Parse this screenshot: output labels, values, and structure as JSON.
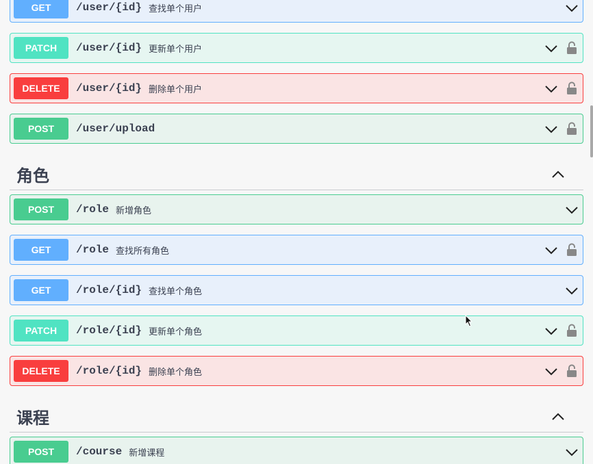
{
  "sections": {
    "role": {
      "title": "角色"
    },
    "course": {
      "title": "课程"
    }
  },
  "ops": [
    {
      "method": "GET",
      "path": "/user/{id}",
      "desc": "查找单个用户"
    },
    {
      "method": "PATCH",
      "path": "/user/{id}",
      "desc": "更新单个用户"
    },
    {
      "method": "DELETE",
      "path": "/user/{id}",
      "desc": "删除单个用户"
    },
    {
      "method": "POST",
      "path": "/user/upload",
      "desc": ""
    },
    {
      "method": "POST",
      "path": "/role",
      "desc": "新增角色"
    },
    {
      "method": "GET",
      "path": "/role",
      "desc": "查找所有角色"
    },
    {
      "method": "GET",
      "path": "/role/{id}",
      "desc": "查找单个角色"
    },
    {
      "method": "PATCH",
      "path": "/role/{id}",
      "desc": "更新单个角色"
    },
    {
      "method": "DELETE",
      "path": "/role/{id}",
      "desc": "删除单个角色"
    },
    {
      "method": "POST",
      "path": "/course",
      "desc": "新增课程"
    }
  ],
  "icons": {
    "chevron": "chevron-down-icon",
    "lock": "lock-icon",
    "collapse": "chevron-up-icon"
  },
  "colors": {
    "get": "#61affe",
    "post": "#49cc90",
    "patch": "#50e3c2",
    "delete": "#f93e3e"
  }
}
